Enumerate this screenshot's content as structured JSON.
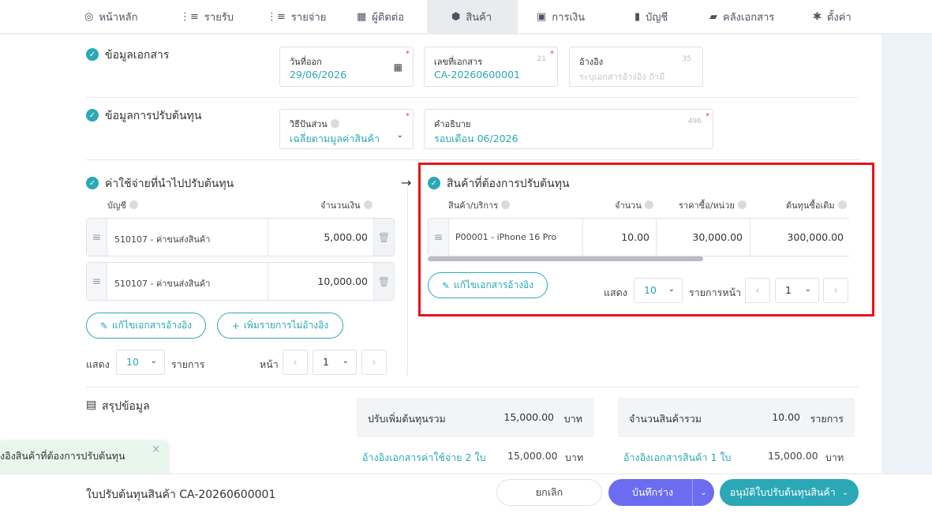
{
  "nav": {
    "items": [
      {
        "label": "หน้าหลัก",
        "icon": "dashboard-icon"
      },
      {
        "label": "รายรับ",
        "icon": "income-icon"
      },
      {
        "label": "รายจ่าย",
        "icon": "expense-icon"
      },
      {
        "label": "ผู้ติดต่อ",
        "icon": "contacts-icon"
      },
      {
        "label": "สินค้า",
        "icon": "box-icon"
      },
      {
        "label": "การเงิน",
        "icon": "money-icon"
      },
      {
        "label": "บัญชี",
        "icon": "book-icon"
      },
      {
        "label": "คลังเอกสาร",
        "icon": "folder-icon"
      },
      {
        "label": "ตั้งค่า",
        "icon": "gear-icon"
      }
    ],
    "active": "สินค้า"
  },
  "doc_info": {
    "title": "ข้อมูลเอกสาร",
    "issue_date": {
      "label": "วันที่ออก",
      "value": "29/06/2026"
    },
    "doc_no": {
      "label": "เลขที่เอกสาร",
      "count": "21",
      "value": "CA-20260600001"
    },
    "reference": {
      "label": "อ้างอิง",
      "count": "35",
      "placeholder": "ระบุเอกสารอ้างอิง ถ้ามี"
    }
  },
  "adjust_info": {
    "title": "ข้อมูลการปรับต้นทุน",
    "method": {
      "label": "วิธีปันส่วน",
      "value": "เฉลี่ยตามมูลค่าสินค้า"
    },
    "description": {
      "label": "คำอธิบาย",
      "count": "496",
      "value": "รอบเดือน 06/2026"
    }
  },
  "expenses": {
    "title": "ค่าใช้จ่ายที่นำไปปรับต้นทุน",
    "col_account": "บัญชี",
    "col_amount": "จำนวนเงิน",
    "rows": [
      {
        "account": "510107 - ค่าขนส่งสินค้า",
        "amount": "5,000.00"
      },
      {
        "account": "510107 - ค่าขนส่งสินค้า",
        "amount": "10,000.00"
      }
    ],
    "edit_ref_label": "แก้ไขเอกสารอ้างอิง",
    "add_item_label": "เพิ่มรายการไม่อ้างอิง",
    "show_label": "แสดง",
    "page_size": "10",
    "items_label": "รายการ",
    "page_label": "หน้า",
    "page": "1"
  },
  "products": {
    "title": "สินค้าที่ต้องการปรับต้นทุน",
    "col_product": "สินค้า/บริการ",
    "col_qty": "จำนวน",
    "col_price": "ราคาซื้อ/หน่วย",
    "col_cost": "ต้นทุนซื้อเดิม",
    "rows": [
      {
        "product": "P00001 - iPhone 16 Pro",
        "qty": "10.00",
        "price": "30,000.00",
        "cost": "300,000.00"
      }
    ],
    "edit_ref_label": "แก้ไขเอกสารอ้างอิง",
    "show_label": "แสดง",
    "page_size": "10",
    "items_page_label": "รายการหน้า",
    "page": "1"
  },
  "summary": {
    "title": "สรุปข้อมูล",
    "total_increase_label": "ปรับเพิ่มต้นทุนรวม",
    "total_increase_value": "15,000.00",
    "currency": "บาท",
    "total_qty_label": "จำนวนสินค้ารวม",
    "total_qty_value": "10.00",
    "qty_unit": "รายการ",
    "expense_ref_link": "อ้างอิงเอกสารค่าใช้จ่าย 2 ใบ",
    "expense_ref_value": "15,000.00",
    "product_ref_link": "อ้างอิงเอกสารสินค้า 1 ใบ",
    "product_ref_value": "15,000.00"
  },
  "toast": {
    "text": "งอิงสินค้าที่ต้องการปรับต้นทุน"
  },
  "footer": {
    "doc_title": "ใบปรับต้นทุนสินค้า CA-20260600001",
    "cancel_label": "ยกเลิก",
    "save_draft_label": "บันทึกร่าง",
    "approve_label": "อนุมัติใบปรับต้นทุนสินค้า"
  },
  "colors": {
    "accent": "#2aa8b5",
    "primary": "#6c6cf0",
    "highlight": "#e8131b"
  }
}
